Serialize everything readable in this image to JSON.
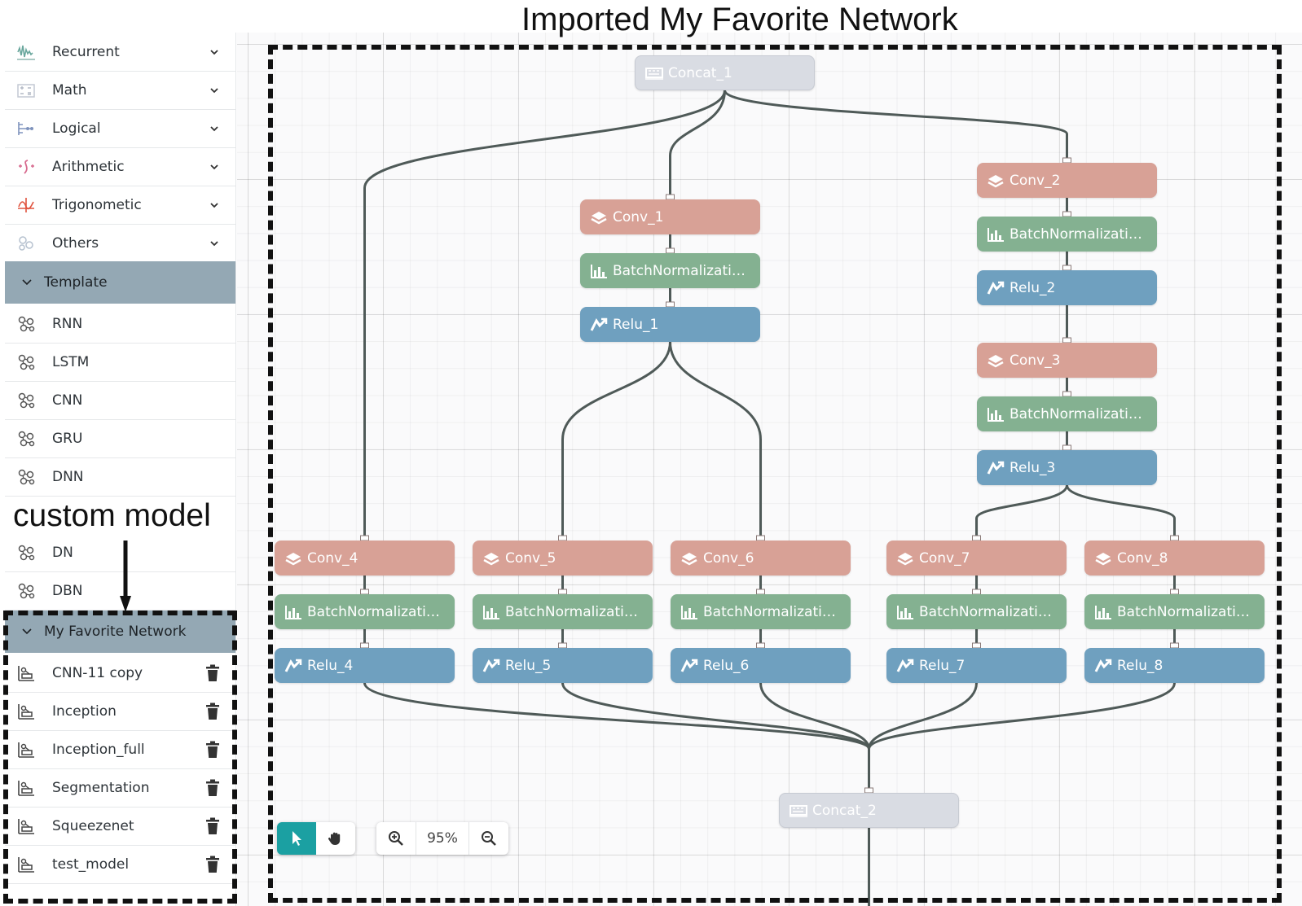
{
  "figure": {
    "title": "Imported My Favorite Network",
    "custom_label": "custom model"
  },
  "sidebar": {
    "categories": [
      {
        "label": "Recurrent",
        "icon": "recurrent-icon"
      },
      {
        "label": "Math",
        "icon": "math-icon"
      },
      {
        "label": "Logical",
        "icon": "logical-icon"
      },
      {
        "label": "Arithmetic",
        "icon": "arithmetic-icon"
      },
      {
        "label": "Trigonometic",
        "icon": "trigonometric-icon"
      },
      {
        "label": "Others",
        "icon": "others-icon"
      }
    ],
    "template": {
      "header": "Template",
      "items": [
        "RNN",
        "LSTM",
        "CNN",
        "GRU",
        "DNN",
        "DN",
        "DBN"
      ]
    },
    "favorites": {
      "header": "My Favorite Network",
      "items": [
        "CNN-11 copy",
        "Inception",
        "Inception_full",
        "Segmentation",
        "Squeezenet",
        "test_model"
      ]
    }
  },
  "graph": {
    "nodes": [
      {
        "id": "concat1",
        "label": "Concat_1",
        "type": "concat"
      },
      {
        "id": "conv1",
        "label": "Conv_1",
        "type": "conv"
      },
      {
        "id": "bn1",
        "label": "BatchNormalization...",
        "type": "bn"
      },
      {
        "id": "relu1",
        "label": "Relu_1",
        "type": "relu"
      },
      {
        "id": "conv2",
        "label": "Conv_2",
        "type": "conv"
      },
      {
        "id": "bn2",
        "label": "BatchNormalization...",
        "type": "bn"
      },
      {
        "id": "relu2",
        "label": "Relu_2",
        "type": "relu"
      },
      {
        "id": "conv3",
        "label": "Conv_3",
        "type": "conv"
      },
      {
        "id": "bn3",
        "label": "BatchNormalization...",
        "type": "bn"
      },
      {
        "id": "relu3",
        "label": "Relu_3",
        "type": "relu"
      },
      {
        "id": "conv4",
        "label": "Conv_4",
        "type": "conv"
      },
      {
        "id": "bn4",
        "label": "BatchNormalization...",
        "type": "bn"
      },
      {
        "id": "relu4",
        "label": "Relu_4",
        "type": "relu"
      },
      {
        "id": "conv5",
        "label": "Conv_5",
        "type": "conv"
      },
      {
        "id": "bn5",
        "label": "BatchNormalization...",
        "type": "bn"
      },
      {
        "id": "relu5",
        "label": "Relu_5",
        "type": "relu"
      },
      {
        "id": "conv6",
        "label": "Conv_6",
        "type": "conv"
      },
      {
        "id": "bn6",
        "label": "BatchNormalization...",
        "type": "bn"
      },
      {
        "id": "relu6",
        "label": "Relu_6",
        "type": "relu"
      },
      {
        "id": "conv7",
        "label": "Conv_7",
        "type": "conv"
      },
      {
        "id": "bn7",
        "label": "BatchNormalization...",
        "type": "bn"
      },
      {
        "id": "relu7",
        "label": "Relu_7",
        "type": "relu"
      },
      {
        "id": "conv8",
        "label": "Conv_8",
        "type": "conv"
      },
      {
        "id": "bn8",
        "label": "BatchNormalization...",
        "type": "bn"
      },
      {
        "id": "relu8",
        "label": "Relu_8",
        "type": "relu"
      },
      {
        "id": "concat2",
        "label": "Concat_2",
        "type": "concat"
      }
    ],
    "edges": [
      [
        "concat1",
        "conv1"
      ],
      [
        "concat1",
        "conv2"
      ],
      [
        "concat1",
        "conv4"
      ],
      [
        "conv1",
        "bn1"
      ],
      [
        "bn1",
        "relu1"
      ],
      [
        "relu1",
        "conv5"
      ],
      [
        "relu1",
        "conv6"
      ],
      [
        "conv2",
        "bn2"
      ],
      [
        "bn2",
        "relu2"
      ],
      [
        "relu2",
        "conv3"
      ],
      [
        "conv3",
        "bn3"
      ],
      [
        "bn3",
        "relu3"
      ],
      [
        "relu3",
        "conv7"
      ],
      [
        "relu3",
        "conv8"
      ],
      [
        "conv4",
        "bn4"
      ],
      [
        "bn4",
        "relu4"
      ],
      [
        "conv5",
        "bn5"
      ],
      [
        "bn5",
        "relu5"
      ],
      [
        "conv6",
        "bn6"
      ],
      [
        "bn6",
        "relu6"
      ],
      [
        "conv7",
        "bn7"
      ],
      [
        "bn7",
        "relu7"
      ],
      [
        "conv8",
        "bn8"
      ],
      [
        "bn8",
        "relu8"
      ],
      [
        "relu4",
        "concat2"
      ],
      [
        "relu5",
        "concat2"
      ],
      [
        "relu6",
        "concat2"
      ],
      [
        "relu7",
        "concat2"
      ],
      [
        "relu8",
        "concat2"
      ]
    ]
  },
  "toolbar": {
    "zoom_label": "95%",
    "select_icon": "pointer-icon",
    "pan_icon": "hand-icon",
    "zoom_in_icon": "zoom-in-icon",
    "zoom_out_icon": "zoom-out-icon"
  },
  "colors": {
    "conv": "#d8a196",
    "bn": "#84b191",
    "relu": "#6fa0bf",
    "concat": "#d9dce3",
    "template_header": "#94a8b4",
    "active_tool": "#1ba0a2",
    "edge": "#4f5a58"
  }
}
